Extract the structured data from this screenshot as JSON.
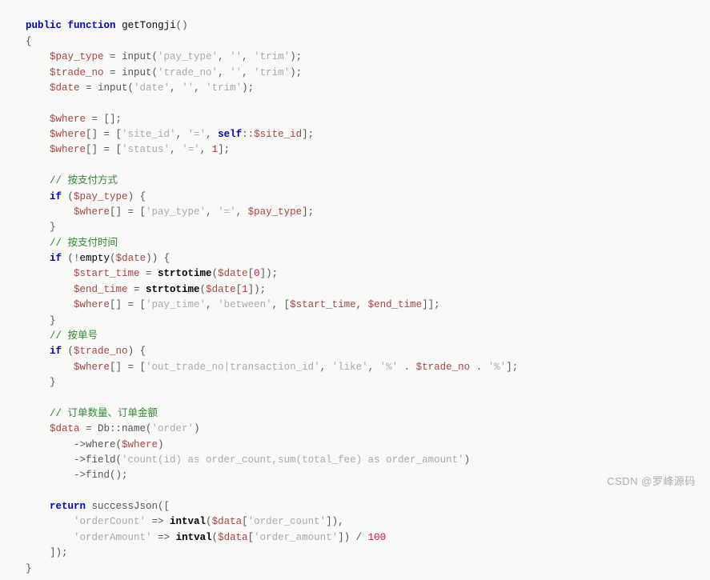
{
  "lines": {
    "l1a": "public",
    "l1b": "function",
    "l1c": "getTongji",
    "l1d": "()",
    "l2": "{",
    "l3a": "$pay_type",
    "l3b": " = input(",
    "l3c": "'pay_type'",
    "l3d": ", ",
    "l3e": "''",
    "l3f": ", ",
    "l3g": "'trim'",
    "l3h": ");",
    "l4a": "$trade_no",
    "l4b": " = input(",
    "l4c": "'trade_no'",
    "l4d": ", ",
    "l4e": "''",
    "l4f": ", ",
    "l4g": "'trim'",
    "l4h": ");",
    "l5a": "$date",
    "l5b": " = input(",
    "l5c": "'date'",
    "l5d": ", ",
    "l5e": "''",
    "l5f": ", ",
    "l5g": "'trim'",
    "l5h": ");",
    "l7a": "$where",
    "l7b": " = [];",
    "l8a": "$where",
    "l8b": "[] = [",
    "l8c": "'site_id'",
    "l8d": ", ",
    "l8e": "'='",
    "l8f": ", ",
    "l8g": "self",
    "l8h": "::",
    "l8i": "$site_id",
    "l8j": "];",
    "l9a": "$where",
    "l9b": "[] = [",
    "l9c": "'status'",
    "l9d": ", ",
    "l9e": "'='",
    "l9f": ", ",
    "l9g": "1",
    "l9h": "];",
    "c1": "// 按支付方式",
    "l12a": "if",
    "l12b": " (",
    "l12c": "$pay_type",
    "l12d": ") {",
    "l13a": "$where",
    "l13b": "[] = [",
    "l13c": "'pay_type'",
    "l13d": ", ",
    "l13e": "'='",
    "l13f": ", ",
    "l13g": "$pay_type",
    "l13h": "];",
    "l14": "}",
    "c2": "// 按支付时间",
    "l16a": "if",
    "l16b": " (!",
    "l16c": "empty",
    "l16d": "(",
    "l16e": "$date",
    "l16f": ")) {",
    "l17a": "$start_time",
    "l17b": " = ",
    "l17c": "strtotime",
    "l17d": "(",
    "l17e": "$date",
    "l17f": "[",
    "l17g": "0",
    "l17h": "]);",
    "l18a": "$end_time",
    "l18b": " = ",
    "l18c": "strtotime",
    "l18d": "(",
    "l18e": "$date",
    "l18f": "[",
    "l18g": "1",
    "l18h": "]);",
    "l19a": "$where",
    "l19b": "[] = [",
    "l19c": "'pay_time'",
    "l19d": ", ",
    "l19e": "'between'",
    "l19f": ", [",
    "l19g": "$start_time",
    "l19h": ", ",
    "l19i": "$end_time",
    "l19j": "]];",
    "l20": "}",
    "c3": "// 按单号",
    "l22a": "if",
    "l22b": " (",
    "l22c": "$trade_no",
    "l22d": ") {",
    "l23a": "$where",
    "l23b": "[] = [",
    "l23c": "'out_trade_no|transaction_id'",
    "l23d": ", ",
    "l23e": "'like'",
    "l23f": ", ",
    "l23g": "'%'",
    "l23h": " . ",
    "l23i": "$trade_no",
    "l23j": " . ",
    "l23k": "'%'",
    "l23l": "];",
    "l24": "}",
    "c4": "// 订单数量、订单金额",
    "l27a": "$data",
    "l27b": " = Db::name(",
    "l27c": "'order'",
    "l27d": ")",
    "l28a": "->where(",
    "l28b": "$where",
    "l28c": ")",
    "l29a": "->field(",
    "l29b": "'count(id) as order_count,sum(total_fee) as order_amount'",
    "l29c": ")",
    "l30a": "->find();",
    "l32a": "return",
    "l32b": " successJson([",
    "l33a": "'orderCount'",
    "l33b": " => ",
    "l33c": "intval",
    "l33d": "(",
    "l33e": "$data",
    "l33f": "[",
    "l33g": "'order_count'",
    "l33h": "]),",
    "l34a": "'orderAmount'",
    "l34b": " => ",
    "l34c": "intval",
    "l34d": "(",
    "l34e": "$data",
    "l34f": "[",
    "l34g": "'order_amount'",
    "l34h": "]) / ",
    "l34i": "100",
    "l35": "]);",
    "l36": "}"
  },
  "watermark": "CSDN @罗峰源码"
}
